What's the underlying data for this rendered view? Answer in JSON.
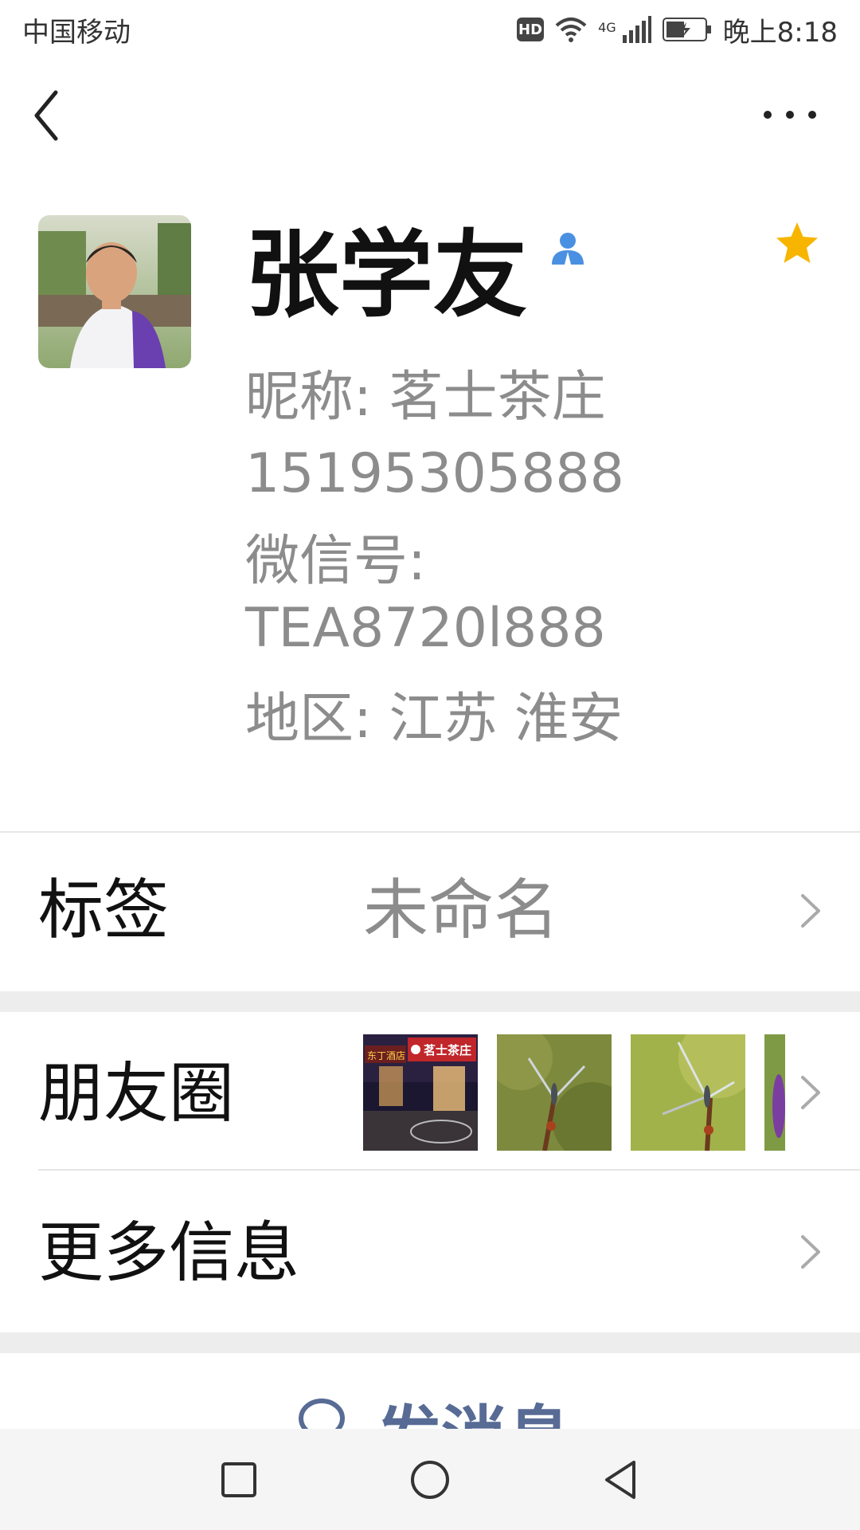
{
  "status_bar": {
    "carrier": "中国移动",
    "hd": "HD",
    "network": "4G",
    "time": "晚上8:18"
  },
  "profile": {
    "name": "张学友",
    "nickname": "昵称: 茗士茶庄",
    "phone": "15195305888",
    "wechat_id_label": "微信号:",
    "wechat_id": "TEA8720l888",
    "region": "地区: 江苏  淮安"
  },
  "rows": {
    "tags_label": "标签",
    "tags_value": "未命名",
    "moments_label": "朋友圈",
    "more_info_label": "更多信息"
  },
  "moments_thumbs": {
    "shop_sign_left": "东丁酒店",
    "shop_sign_right": "茗士茶庄"
  },
  "actions": {
    "send_message": "发消息"
  },
  "colors": {
    "accent_link": "#576b95",
    "star": "#f7b500",
    "contact_badge": "#4a90e2",
    "secondary_text": "#8c8c8c"
  },
  "icons": [
    "back-arrow-icon",
    "more-dots-icon",
    "contact-badge-icon",
    "star-icon",
    "chevron-right-icon",
    "chat-bubble-icon",
    "recent-apps-icon",
    "home-icon",
    "back-triangle-icon"
  ]
}
